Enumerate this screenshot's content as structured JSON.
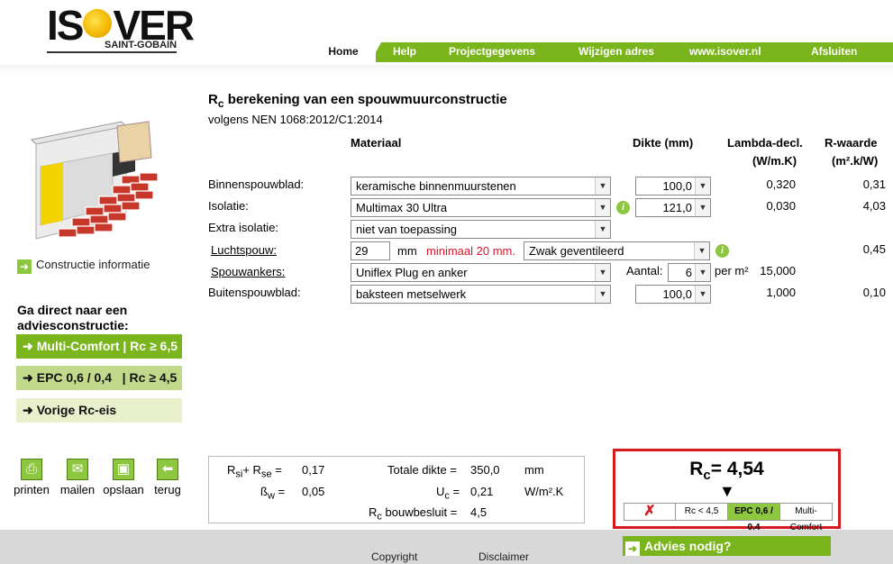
{
  "brand": {
    "logo_text": "ISOVER",
    "logo_sub": "SAINT-GOBAIN"
  },
  "nav": [
    "Home",
    "Help",
    "Projectgegevens",
    "Wijzigen adres",
    "www.isover.nl",
    "Afsluiten"
  ],
  "sidebar": {
    "construction_info": "Constructie informatie",
    "go_direct": "Ga direct naar een adviesconstructie:",
    "advice_buttons": [
      "Multi-Comfort | Rc ≥ 6,5",
      "EPC 0,6 / 0,4   | Rc ≥ 4,5",
      "Vorige Rc-eis"
    ],
    "tools": [
      "printen",
      "mailen",
      "opslaan",
      "terug"
    ]
  },
  "form": {
    "title_pre": "R",
    "title_sub": "c",
    "title_post": " berekening van een spouwmuurconstructie",
    "subtitle": "volgens NEN 1068:2012/C1:2014",
    "col_material": "Materiaal",
    "col_thickness": "Dikte (mm)",
    "col_lambda": "Lambda-decl.",
    "col_lambda_unit": "(W/m.K)",
    "col_r": "R-waarde",
    "col_r_unit": "(m².k/W)",
    "rows": [
      {
        "label": "Binnenspouwblad:",
        "material": "keramische binnenmuurstenen",
        "thickness": "100,0",
        "lambda": "0,320",
        "r": "0,31"
      },
      {
        "label": "Isolatie:",
        "material": "Multimax 30 Ultra",
        "thickness": "121,0",
        "lambda": "0,030",
        "r": "4,03"
      },
      {
        "label": "Extra isolatie:",
        "material": "niet van toepassing"
      },
      {
        "label": "Luchtspouw:",
        "value": "29",
        "unit": "mm",
        "note": "minimaal 20 mm.",
        "ventilation": "Zwak geventileerd",
        "r": "0,45"
      },
      {
        "label": "Spouwankers:",
        "material": "Uniflex Plug en anker",
        "count_label": "Aantal:",
        "count": "6",
        "per": "per m²",
        "lambda": "15,000"
      },
      {
        "label": "Buitenspouwblad:",
        "material": "baksteen metselwerk",
        "thickness": "100,0",
        "lambda": "1,000",
        "r": "0,10"
      }
    ]
  },
  "summary": {
    "rsi_rse_label_a": "R",
    "rsi_rse_sub_a": "si",
    "rsi_rse_label_b": "+ R",
    "rsi_rse_sub_b": "se",
    "rsi_rse_eq": "=",
    "rsi_rse": "0,17",
    "beta_label": "ß",
    "beta_sub": "w",
    "beta_eq": "=",
    "beta": "0,05",
    "total_label": "Totale dikte",
    "total_eq": "=",
    "total": "350,0",
    "total_unit": "mm",
    "uc_label": "U",
    "uc_sub": "c",
    "uc_eq": "=",
    "uc": "0,21",
    "uc_unit": "W/m².K",
    "rc_bb_label": "R",
    "rc_bb_sub": "c",
    "rc_bb_label2": " bouwbesluit",
    "rc_bb_eq": "=",
    "rc_bb": "4,5"
  },
  "result": {
    "rc_label": "R",
    "rc_sub": "c",
    "rc_value": "= 4,54",
    "scale": [
      "✗",
      "Rc < 4,5",
      "EPC 0,6 / 0,4",
      "Multi-Comfort"
    ],
    "colors": {
      "active": "#8dc63f",
      "border": "#d71920"
    }
  },
  "footer": {
    "copyright": "Copyright",
    "disclaimer": "Disclaimer",
    "advies": "Advies nodig?"
  }
}
